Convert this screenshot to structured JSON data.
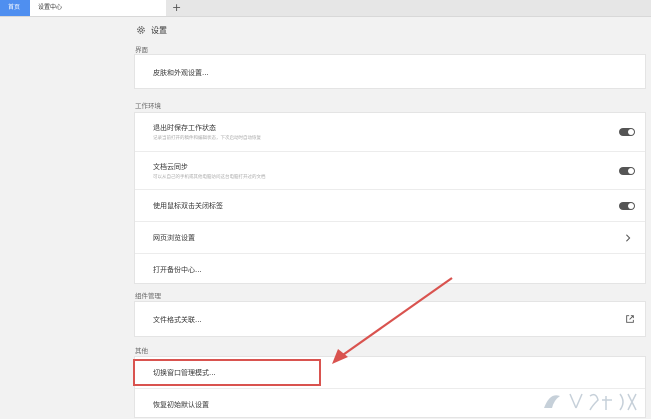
{
  "tabs": {
    "home": "首页",
    "active": "设置中心",
    "add": "+"
  },
  "header": {
    "title": "设置"
  },
  "sections": {
    "interface": {
      "label": "界面",
      "items": [
        {
          "label": "皮肤和外观设置..."
        }
      ]
    },
    "workspace": {
      "label": "工作环境",
      "items": [
        {
          "label": "退出时保存工作状态",
          "desc": "记录当前打开的稿件和编辑状态，下次启动时自动恢复",
          "toggle": "on"
        },
        {
          "label": "文档云同步",
          "desc": "可以从自己的手机或其他电脑访问这台电脑打开过的文档",
          "toggle": "on"
        },
        {
          "label": "使用鼠标双击关闭标签",
          "toggle": "on"
        },
        {
          "label": "网页浏览设置"
        },
        {
          "label": "打开备份中心..."
        }
      ]
    },
    "components": {
      "label": "组件管理",
      "items": [
        {
          "label": "文件格式关联..."
        }
      ]
    },
    "other": {
      "label": "其他",
      "items": [
        {
          "label": "切换窗口管理模式..."
        },
        {
          "label": "恢复初始默认设置"
        }
      ]
    }
  },
  "colors": {
    "accent": "#4f8ff0",
    "highlight": "#d9534f",
    "toggle": "#555555"
  }
}
